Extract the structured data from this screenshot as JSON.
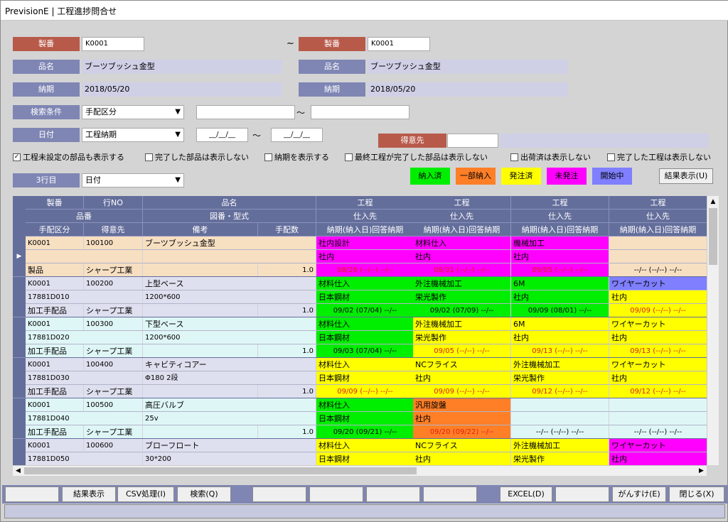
{
  "title": "PrevisionE | 工程進捗問合せ",
  "filters": {
    "seiban_label": "製番",
    "seiban_from": "K0001",
    "tilde": "~",
    "seiban_to": "K0001",
    "hinmei_label": "品名",
    "hinmei_from": "ブーツブッシュ金型",
    "hinmei_to": "ブーツブッシュ金型",
    "noki_label": "納期",
    "noki_from": "2018/05/20",
    "noki_to": "2018/05/20",
    "kensaku_label": "検索条件",
    "kensaku_value": "手配区分",
    "kensaku_tilde": "～",
    "hizuke_label": "日付",
    "hizuke_value": "工程納期",
    "date_from": "__/__/__",
    "date_tilde": "～",
    "date_to": "__/__/__",
    "tokui_label": "得意先",
    "row3_label": "3行目",
    "row3_value": "日付"
  },
  "checkboxes": [
    {
      "label": "工程未設定の部品も表示する",
      "checked": "✓"
    },
    {
      "label": "完了した部品は表示しない",
      "checked": ""
    },
    {
      "label": "納期を表示する",
      "checked": ""
    },
    {
      "label": "最終工程が完了した部品は表示しない",
      "checked": ""
    },
    {
      "label": "出荷済は表示しない",
      "checked": ""
    },
    {
      "label": "完了した工程は表示しない",
      "checked": ""
    }
  ],
  "legend": [
    {
      "label": "納入済",
      "color": "#00ee00"
    },
    {
      "label": "一部納入",
      "color": "#ff7f27"
    },
    {
      "label": "発注済",
      "color": "#ffff00"
    },
    {
      "label": "未発注",
      "color": "#ff00ff"
    },
    {
      "label": "開始中",
      "color": "#7f7fff"
    }
  ],
  "result_button": "結果表示(U)",
  "headers": {
    "r1": [
      "製番",
      "行NO",
      "品名",
      "工程",
      "工程",
      "工程",
      "工程"
    ],
    "r2": [
      "品番",
      "図番・型式",
      "仕入先",
      "仕入先",
      "仕入先",
      "仕入先"
    ],
    "r3": [
      "手配区分",
      "得意先",
      "備考",
      "手配数",
      "納期(納入日)回答納期",
      "納期(納入日)回答納期",
      "納期(納入日)回答納期",
      "納期(納入日)回答納期"
    ]
  },
  "rows": [
    {
      "seiban": "K0001",
      "gyo": "100100",
      "hinmei": "ブーツブッシュ金型",
      "hinban": "",
      "zuban": "",
      "kubun": "製品",
      "tokui": "シャープ工業",
      "qty": "1.0",
      "bg": "#f7dfc2",
      "procs": [
        {
          "name": "社内設計",
          "sup": "社内",
          "date": "08/26 (--/--) --/--",
          "color": "#ff00ff",
          "red": true
        },
        {
          "name": "材料仕入",
          "sup": "社内",
          "date": "08/31 (--/--) --/--",
          "color": "#ff00ff",
          "red": true
        },
        {
          "name": "機械加工",
          "sup": "社内",
          "date": "09/05 (--/--) --/--",
          "color": "#ff00ff",
          "red": true
        },
        {
          "name": "",
          "sup": "",
          "date": "--/-- (--/--) --/--",
          "color": "#f7dfc2",
          "red": false
        }
      ]
    },
    {
      "seiban": "K0001",
      "gyo": "100200",
      "hinmei": "上型ベース",
      "hinban": "17881D010",
      "zuban": "1200*600",
      "kubun": "加工手配品",
      "tokui": "シャープ工業",
      "qty": "1.0",
      "bg": "#dfe0ef",
      "procs": [
        {
          "name": "材料仕入",
          "sup": "日本鋼材",
          "date": "09/02 (07/04) --/--",
          "color": "#00ee00",
          "red": false
        },
        {
          "name": "外注機械加工",
          "sup": "栄光製作",
          "date": "09/02 (07/09) --/--",
          "color": "#00ee00",
          "red": false
        },
        {
          "name": "6M",
          "sup": "社内",
          "date": "09/09 (08/01) --/--",
          "color": "#00ee00",
          "red": false
        },
        {
          "name": "ワイヤーカット",
          "sup": "社内",
          "date": "09/09 (--/--) --/--",
          "color": "#7f7fff",
          "red": true,
          "supcolor": "#ffff00"
        }
      ]
    },
    {
      "seiban": "K0001",
      "gyo": "100300",
      "hinmei": "下型ベース",
      "hinban": "17881D020",
      "zuban": "1200*600",
      "kubun": "加工手配品",
      "tokui": "シャープ工業",
      "qty": "1.0",
      "bg": "#dff6f6",
      "procs": [
        {
          "name": "材料仕入",
          "sup": "日本鋼材",
          "date": "09/03 (07/04) --/--",
          "color": "#00ee00",
          "red": false
        },
        {
          "name": "外注機械加工",
          "sup": "栄光製作",
          "date": "09/05 (--/--) --/--",
          "color": "#ffff00",
          "red": true
        },
        {
          "name": "6M",
          "sup": "社内",
          "date": "09/13 (--/--) --/--",
          "color": "#ffff00",
          "red": true
        },
        {
          "name": "ワイヤーカット",
          "sup": "社内",
          "date": "09/13 (--/--) --/--",
          "color": "#ffff00",
          "red": true
        }
      ]
    },
    {
      "seiban": "K0001",
      "gyo": "100400",
      "hinmei": "キャビティコアー",
      "hinban": "17881D030",
      "zuban": "Φ180 2段",
      "kubun": "加工手配品",
      "tokui": "シャープ工業",
      "qty": "1.0",
      "bg": "#dfe0ef",
      "procs": [
        {
          "name": "材料仕入",
          "sup": "日本鋼材",
          "date": "09/09 (--/--) --/--",
          "color": "#ffff00",
          "red": true
        },
        {
          "name": "NCフライス",
          "sup": "社内",
          "date": "09/09 (--/--) --/--",
          "color": "#ffff00",
          "red": true
        },
        {
          "name": "外注機械加工",
          "sup": "栄光製作",
          "date": "09/12 (--/--) --/--",
          "color": "#ffff00",
          "red": true
        },
        {
          "name": "ワイヤーカット",
          "sup": "社内",
          "date": "09/12 (--/--) --/--",
          "color": "#ffff00",
          "red": true
        }
      ]
    },
    {
      "seiban": "K0001",
      "gyo": "100500",
      "hinmei": "高圧バルブ",
      "hinban": "17881D040",
      "zuban": "25v",
      "kubun": "加工手配品",
      "tokui": "シャープ工業",
      "qty": "1.0",
      "bg": "#dff6f6",
      "procs": [
        {
          "name": "材料仕入",
          "sup": "日本鋼材",
          "date": "09/20 (09/21) --/--",
          "color": "#00ee00",
          "red": false
        },
        {
          "name": "汎用旋盤",
          "sup": "社内",
          "date": "09/20 (09/22) --/--",
          "color": "#ff7f27",
          "red": true
        },
        {
          "name": "",
          "sup": "",
          "date": "--/-- (--/--) --/--",
          "color": "#dff6f6",
          "red": false
        },
        {
          "name": "",
          "sup": "",
          "date": "--/-- (--/--) --/--",
          "color": "#dff6f6",
          "red": false
        }
      ]
    },
    {
      "seiban": "K0001",
      "gyo": "100600",
      "hinmei": "ブローフロート",
      "hinban": "17881D050",
      "zuban": "30*200",
      "kubun": "",
      "tokui": "",
      "qty": "",
      "bg": "#dfe0ef",
      "procs": [
        {
          "name": "材料仕入",
          "sup": "日本鋼材",
          "date": "",
          "color": "#ffff00",
          "red": false
        },
        {
          "name": "NCフライス",
          "sup": "社内",
          "date": "",
          "color": "#ffff00",
          "red": false
        },
        {
          "name": "外注機械加工",
          "sup": "栄光製作",
          "date": "",
          "color": "#ffff00",
          "red": false
        },
        {
          "name": "ワイヤーカット",
          "sup": "社内",
          "date": "",
          "color": "#ff00ff",
          "red": false
        }
      ]
    }
  ],
  "bottom_buttons": [
    "",
    "結果表示",
    "CSV処理(I)",
    "検索(Q)",
    "",
    "",
    "",
    "",
    "EXCEL(D)",
    "",
    "がんすけ(E)",
    "閉じる(X)"
  ]
}
